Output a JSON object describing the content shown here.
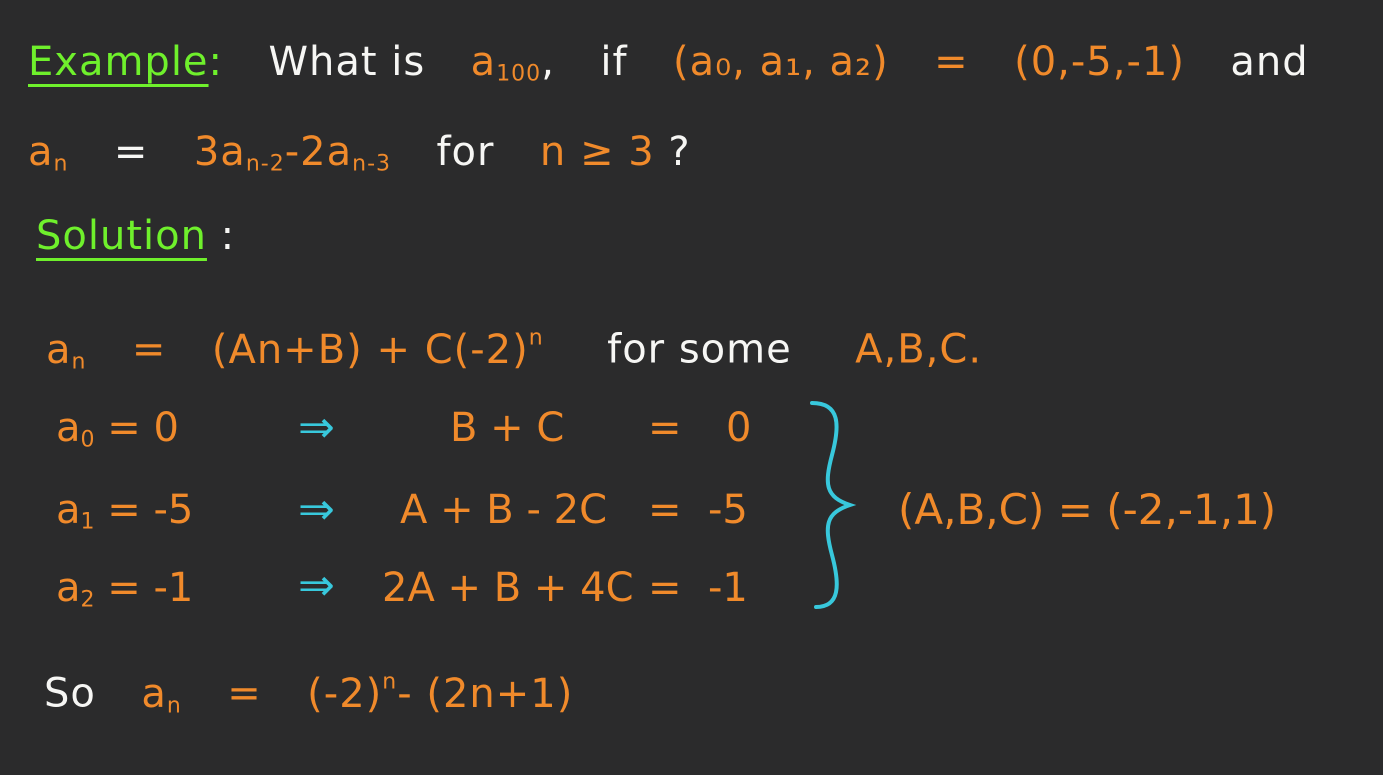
{
  "example": {
    "label": "Example",
    "colon": ":",
    "question_pre": "What is",
    "a100": "a",
    "a100_sub": "100",
    "comma": ",",
    "if": "if",
    "tuple_lhs": "(a₀, a₁, a₂)",
    "equals": "=",
    "tuple_rhs": "(0,-5,-1)",
    "and": "and"
  },
  "recurrence": {
    "lhs": "a",
    "lhs_sub": "n",
    "equals": "=",
    "term1": "3a",
    "term1_sub": "n-2",
    "minus": "-",
    "term2": "2a",
    "term2_sub": "n-3",
    "for": "for",
    "condition": "n ≥ 3",
    "qmark": "?"
  },
  "solution": {
    "label": "Solution",
    "colon": ":"
  },
  "general_form": {
    "lhs": "a",
    "lhs_sub": "n",
    "equals": "=",
    "expr": "(An+B) + C(-2)",
    "expr_sup": "n",
    "for_some": "for some",
    "constants": "A,B,C."
  },
  "system": {
    "rows": [
      {
        "lhs": "a",
        "lhs_sub": "0",
        "lhs_val": "= 0",
        "arrow": "⇒",
        "eq": "B + C",
        "eq_sign": "=",
        "rhs": "0"
      },
      {
        "lhs": "a",
        "lhs_sub": "1",
        "lhs_val": "= -5",
        "arrow": "⇒",
        "eq": "A + B - 2C",
        "eq_sign": "=",
        "rhs": "-5"
      },
      {
        "lhs": "a",
        "lhs_sub": "2",
        "lhs_val": "= -1",
        "arrow": "⇒",
        "eq": "2A + B + 4C",
        "eq_sign": "=",
        "rhs": "-1"
      }
    ],
    "result": "(A,B,C) = (-2,-1,1)"
  },
  "conclusion": {
    "so": "So",
    "lhs": "a",
    "lhs_sub": "n",
    "equals": "=",
    "rhs_pre": "(-2)",
    "rhs_sup": "n",
    "rhs_post": "- (2n+1)"
  },
  "colors": {
    "background": "#2b2b2c",
    "heading_green": "#6ff02c",
    "math_orange": "#f08a2b",
    "text_white": "#f6f6f4",
    "arrow_cyan": "#38c8dc"
  }
}
